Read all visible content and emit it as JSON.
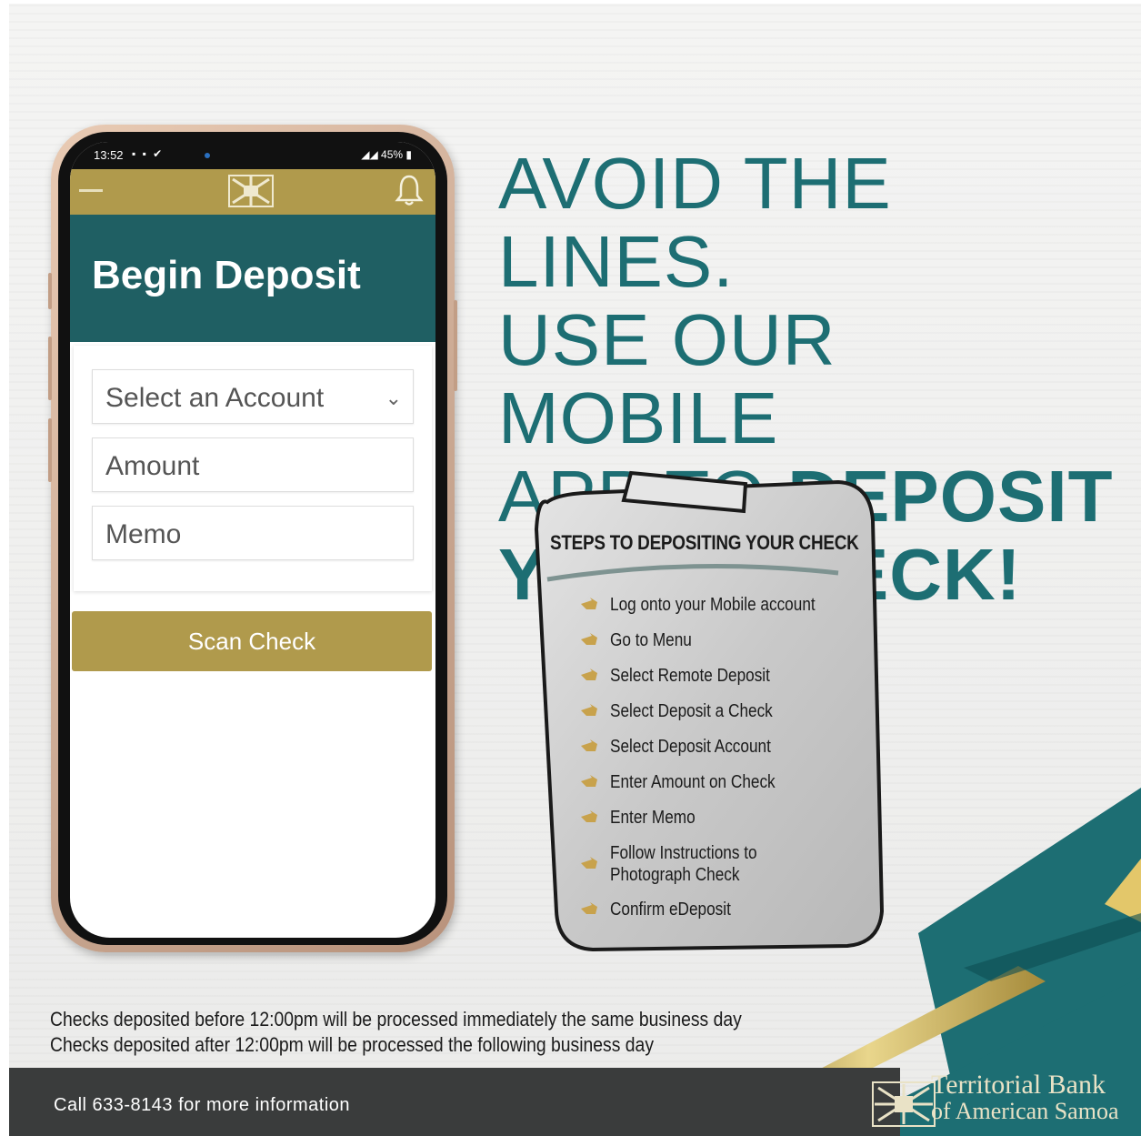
{
  "phone": {
    "status_time": "13:52",
    "status_left_icons": "▪ ▪ ✔",
    "status_battery": "45%",
    "deposit_title": "Begin Deposit",
    "account_select": "Select  an  Account",
    "amount_placeholder": "Amount",
    "memo_placeholder": "Memo",
    "scan_button": "Scan Check"
  },
  "headline": {
    "line1": "AVOID THE LINES.",
    "line2": "USE OUR MOBILE",
    "line3_regular": "APP TO ",
    "line3_bold": "DEPOSIT",
    "line4": "YOUR CHECK!"
  },
  "clipboard": {
    "title": "STEPS TO DEPOSITING YOUR CHECK",
    "steps": [
      "Log onto your Mobile account",
      "Go to Menu",
      "Select Remote Deposit",
      "Select Deposit a Check",
      "Select Deposit Account",
      "Enter Amount on Check",
      "Enter Memo",
      "Follow Instructions to",
      "Photograph Check",
      "Confirm eDeposit"
    ]
  },
  "notes": {
    "line1": "Checks deposited before 12:00pm will be processed immediately the same business day",
    "line2": "Checks deposited after 12:00pm will be processed the following business day"
  },
  "footer": {
    "call_text": "Call 633-8143 for more information",
    "brand_line1": "Territorial Bank",
    "brand_line2": "of American Samoa"
  },
  "colors": {
    "teal": "#1d6e73",
    "gold": "#b09a4c",
    "dark_bar": "#3a3c3c"
  }
}
